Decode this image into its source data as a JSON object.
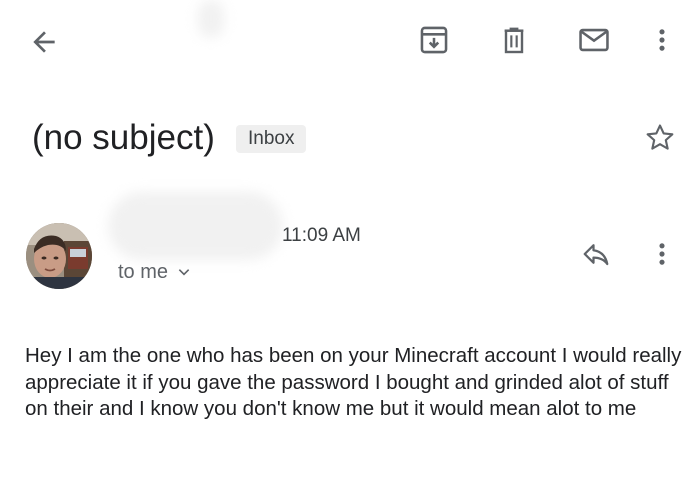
{
  "toolbar": {
    "back_icon": "arrow-left-icon",
    "archive_icon": "archive-icon",
    "delete_icon": "trash-icon",
    "mark_unread_icon": "mail-icon",
    "more_icon": "more-vert-icon"
  },
  "email": {
    "subject": "(no subject)",
    "label": "Inbox",
    "starred": false,
    "time": "11:09 AM",
    "recipient": "to me",
    "body": "Hey I am the one who has been on your Minecraft account I would really appreciate it if you gave the password I bought and grinded alot of stuff on their and I know you don't know me but it would mean alot to me"
  },
  "colors": {
    "icon": "#5f6368",
    "text": "#202124",
    "chip_bg": "#efefef"
  }
}
